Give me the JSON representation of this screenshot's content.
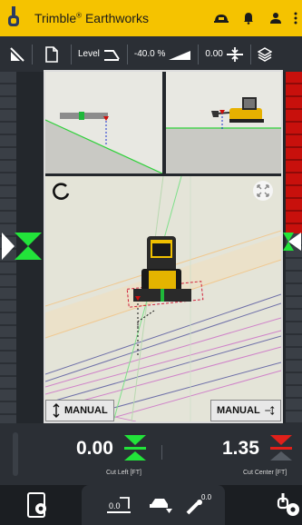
{
  "header": {
    "brand": "Trimble",
    "reg": "®",
    "product": "Earthworks",
    "icons": [
      "hardhat-icon",
      "helmet-icon",
      "notification-icon",
      "user-icon",
      "more-icon"
    ]
  },
  "toolbar": {
    "mode_label": "Level",
    "slope_value": "-40.0 %",
    "offset_value": "0.00"
  },
  "views": {
    "front_mode": "MANUAL",
    "side_mode": "MANUAL"
  },
  "readout": {
    "left_value": "0.00",
    "left_caption": "Cut Left",
    "left_unit": "[FT]",
    "right_value": "1.35",
    "right_caption": "Cut Center",
    "right_unit": "[FT]",
    "indicator_color_left": "#22e33a",
    "indicator_color_right": "#e0201a"
  },
  "bottom_nav": {
    "center_value": "0.0"
  },
  "colors": {
    "header_bg": "#f5c300",
    "accent_green": "#22e33a",
    "accent_red": "#d0100c"
  }
}
